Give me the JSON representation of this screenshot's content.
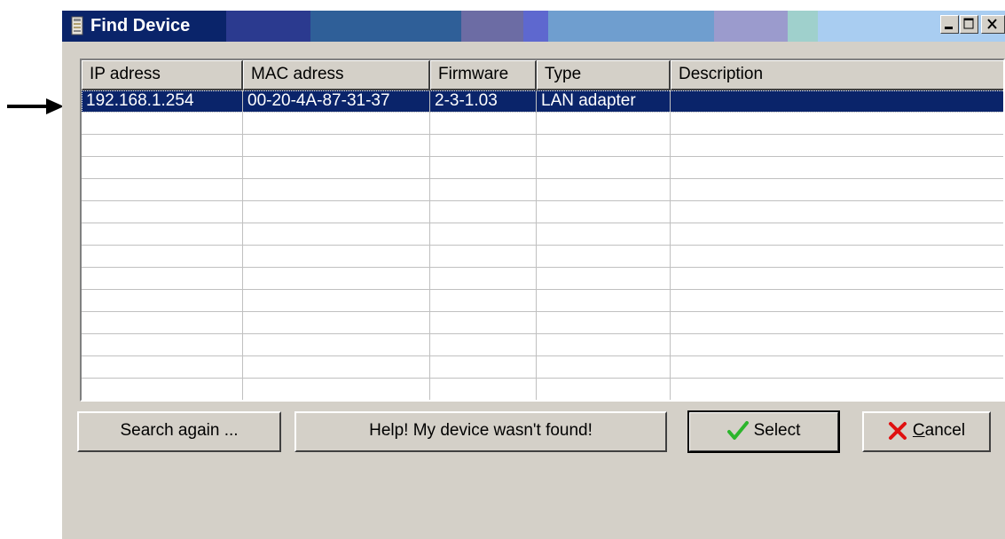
{
  "window": {
    "title": "Find Device"
  },
  "columns": [
    {
      "label": "IP adress"
    },
    {
      "label": "MAC adress"
    },
    {
      "label": "Firmware"
    },
    {
      "label": "Type"
    },
    {
      "label": "Description"
    }
  ],
  "rows": [
    {
      "ip": "192.168.1.254",
      "mac": "00-20-4A-87-31-37",
      "firmware": "2-3-1.03",
      "type": "LAN adapter",
      "description": "",
      "selected": true
    }
  ],
  "buttons": {
    "search_again": "Search again ...",
    "help": "Help! My device wasn't found!",
    "select": "Select",
    "cancel_first": "C",
    "cancel_rest": "ancel"
  },
  "colors": {
    "selection": "#0a246a",
    "dialog_face": "#d4d0c8",
    "check_icon": "#2cb52c",
    "cancel_icon": "#e01010"
  }
}
